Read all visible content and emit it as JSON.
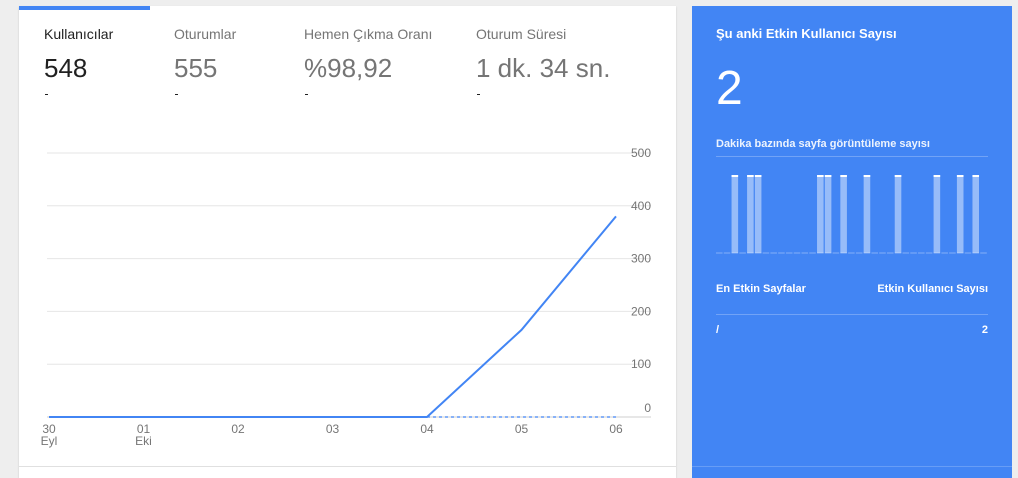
{
  "tabs": [
    {
      "label": "Kullanıcılar",
      "value": "548"
    },
    {
      "label": "Oturumlar",
      "value": "555"
    },
    {
      "label": "Hemen Çıkma Oranı",
      "value": "%98,92"
    },
    {
      "label": "Oturum Süresi",
      "value": "1 dk. 34 sn."
    }
  ],
  "chart_data": {
    "type": "line",
    "x_ticks": [
      {
        "day": "30",
        "month": "Eyl"
      },
      {
        "day": "01",
        "month": "Eki"
      },
      {
        "day": "02",
        "month": ""
      },
      {
        "day": "03",
        "month": ""
      },
      {
        "day": "04",
        "month": ""
      },
      {
        "day": "05",
        "month": ""
      },
      {
        "day": "06",
        "month": ""
      }
    ],
    "y_ticks": [
      "500",
      "400",
      "300",
      "200",
      "100",
      "0"
    ],
    "ylim": [
      0,
      500
    ],
    "grid": true,
    "series": [
      {
        "values": [
          0,
          0,
          0,
          0,
          0,
          165,
          380
        ]
      }
    ],
    "colors": {
      "line": "#4285f4",
      "grid": "#e6e6e6",
      "axis_text": "#757575"
    }
  },
  "realtime": {
    "title": "Şu anki Etkin Kullanıcı Sayısı",
    "active_count": "2",
    "pageviews_label": "Dakika bazında sayfa görüntüleme sayısı",
    "pageviews_per_minute": [
      0,
      0,
      1,
      0,
      1,
      1,
      0,
      0,
      0,
      0,
      0,
      0,
      0,
      1,
      1,
      0,
      1,
      0,
      0,
      1,
      0,
      0,
      0,
      1,
      0,
      0,
      0,
      0,
      1,
      0,
      0,
      1,
      0,
      1,
      0
    ],
    "top_pages_header": "En Etkin Sayfalar",
    "active_users_header": "Etkin Kullanıcı Sayısı",
    "rows": [
      {
        "page": "/",
        "users": "2"
      }
    ]
  }
}
